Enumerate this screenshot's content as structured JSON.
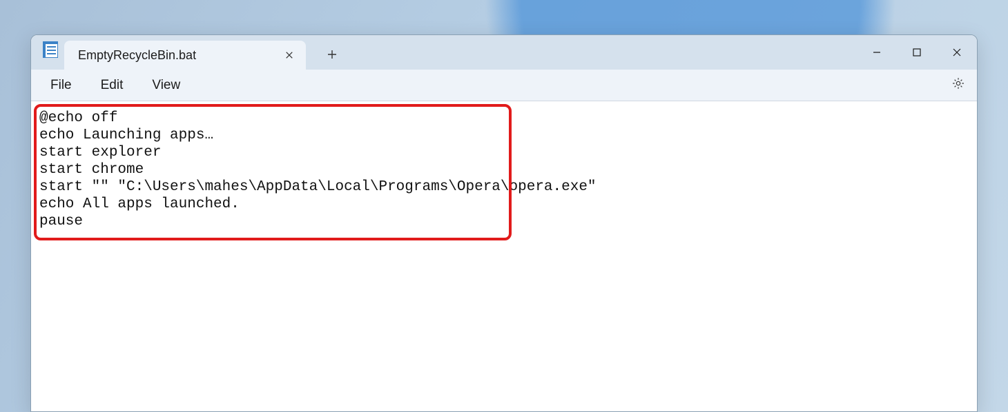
{
  "tab": {
    "title": "EmptyRecycleBin.bat"
  },
  "menu": {
    "file": "File",
    "edit": "Edit",
    "view": "View"
  },
  "editor": {
    "lines": [
      "@echo off",
      "echo Launching apps…",
      "start explorer",
      "start chrome",
      "start \"\" \"C:\\Users\\mahes\\AppData\\Local\\Programs\\Opera\\opera.exe\"",
      "echo All apps launched.",
      "pause"
    ]
  }
}
